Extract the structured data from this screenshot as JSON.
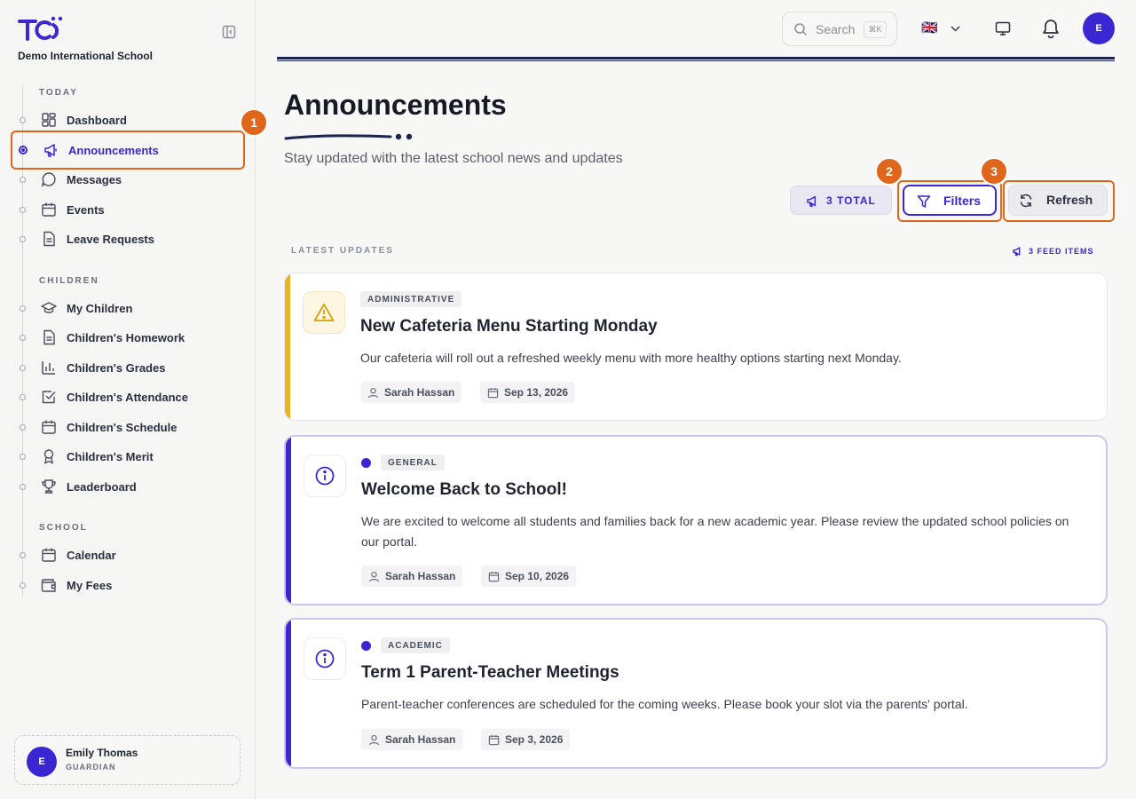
{
  "sidebar": {
    "school_name": "Demo International School",
    "sections": [
      {
        "title": "TODAY"
      },
      {
        "title": "CHILDREN"
      },
      {
        "title": "SCHOOL"
      }
    ],
    "items": [
      {
        "label": "Dashboard",
        "icon": "dashboard-icon"
      },
      {
        "label": "Announcements",
        "icon": "megaphone-icon",
        "active": true
      },
      {
        "label": "Messages",
        "icon": "chat-icon"
      },
      {
        "label": "Events",
        "icon": "calendar-icon"
      },
      {
        "label": "Leave Requests",
        "icon": "document-icon"
      },
      {
        "label": "My Children",
        "icon": "graduation-cap-icon"
      },
      {
        "label": "Children's Homework",
        "icon": "document-icon"
      },
      {
        "label": "Children's Grades",
        "icon": "bar-chart-icon"
      },
      {
        "label": "Children's Attendance",
        "icon": "check-square-icon"
      },
      {
        "label": "Children's Schedule",
        "icon": "calendar-icon"
      },
      {
        "label": "Children's Merit",
        "icon": "award-icon"
      },
      {
        "label": "Leaderboard",
        "icon": "trophy-icon"
      },
      {
        "label": "Calendar",
        "icon": "calendar-icon"
      },
      {
        "label": "My Fees",
        "icon": "wallet-icon"
      }
    ],
    "user": {
      "initial": "E",
      "name": "Emily Thomas",
      "role": "GUARDIAN"
    }
  },
  "topbar": {
    "search_placeholder": "Search",
    "search_shortcut": "⌘K",
    "language_flag": "🇬🇧",
    "avatar_initial": "E"
  },
  "header": {
    "title": "Announcements",
    "subtitle": "Stay updated with the latest school news and updates",
    "total_label": "3 TOTAL",
    "filters_label": "Filters",
    "refresh_label": "Refresh"
  },
  "badges": [
    "1",
    "2",
    "3"
  ],
  "feed": {
    "label": "LATEST UPDATES",
    "count_label": "3 FEED ITEMS"
  },
  "announcements": [
    {
      "category": "ADMINISTRATIVE",
      "title": "New Cafeteria Menu Starting Monday",
      "body": "Our cafeteria will roll out a refreshed weekly menu with more healthy options starting next Monday.",
      "author": "Sarah Hassan",
      "date": "Sep 13, 2026",
      "icon": "warning-icon",
      "unread": false
    },
    {
      "category": "GENERAL",
      "title": "Welcome Back to School!",
      "body": "We are excited to welcome all students and families back for a new academic year. Please review the updated school policies on our portal.",
      "author": "Sarah Hassan",
      "date": "Sep 10, 2026",
      "icon": "info-icon",
      "unread": true
    },
    {
      "category": "ACADEMIC",
      "title": "Term 1 Parent-Teacher Meetings",
      "body": "Parent-teacher conferences are scheduled for the coming weeks. Please book your slot via the parents' portal.",
      "author": "Sarah Hassan",
      "date": "Sep 3, 2026",
      "icon": "info-icon",
      "unread": true
    }
  ],
  "colors": {
    "accent": "#3b27d1",
    "highlight": "#e0661b",
    "warning": "#e8b420"
  }
}
